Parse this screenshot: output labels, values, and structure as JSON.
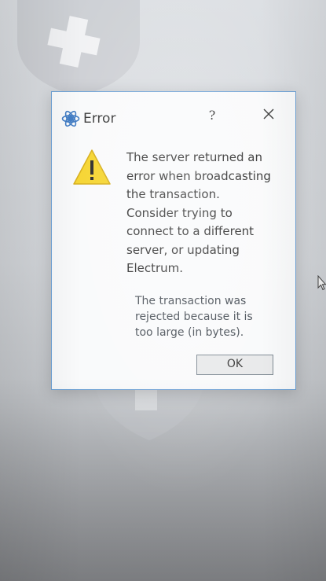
{
  "dialog": {
    "title": "Error",
    "help_label": "?",
    "icons": {
      "app": "electrum-logo-icon",
      "warning": "warning-triangle-icon",
      "close": "close-icon",
      "background": "shield-plus-icon"
    },
    "main_message_lines": [
      "The server returned an",
      "error when broadcasting",
      "the transaction.",
      "Consider trying to",
      "connect to a different",
      "server, or updating",
      "Electrum."
    ],
    "detail_message_lines": [
      "The transaction was",
      "rejected because it is",
      "too large (in bytes)."
    ],
    "ok_label": "OK"
  },
  "colors": {
    "dialog_border": "#6ea2d6",
    "warning_fill": "#f5d327",
    "electrum_blue": "#3b78c2"
  }
}
